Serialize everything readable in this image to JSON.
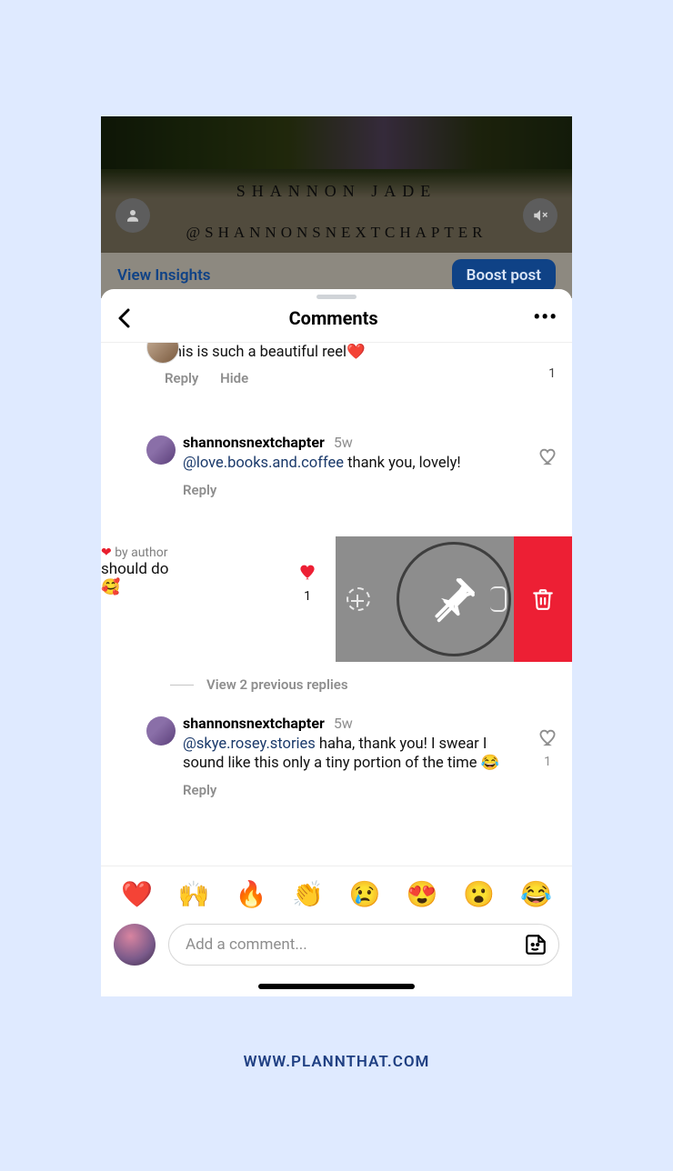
{
  "post": {
    "author_name": "SHANNON JADE",
    "author_handle": "@SHANNONSNEXTCHAPTER",
    "view_insights": "View Insights",
    "boost": "Boost post"
  },
  "sheet": {
    "title": "Comments"
  },
  "cut_comment": {
    "text": "This is such a beautiful reel",
    "heart": "❤️",
    "like_count": "1",
    "reply": "Reply",
    "hide": "Hide"
  },
  "reply1": {
    "username": "shannonsnextchapter",
    "time": "5w",
    "mention": "@love.books.and.coffee",
    "body_rest": " thank you, lovely!",
    "reply": "Reply"
  },
  "swipe": {
    "byline_icon": "❤",
    "byline": " by author",
    "line1": "should do",
    "line2": "🥰",
    "like_count": "1"
  },
  "view_prev": "View 2 previous replies",
  "reply2": {
    "username": "shannonsnextchapter",
    "time": "5w",
    "mention": "@skye.rosey.stories",
    "body_rest": " haha, thank you! I swear I sound like this only a tiny portion of the time 😂",
    "like_count": "1",
    "reply": "Reply"
  },
  "composer": {
    "emojis": [
      "❤️",
      "🙌",
      "🔥",
      "👏",
      "😢",
      "😍",
      "😮",
      "😂"
    ],
    "placeholder": "Add a comment..."
  },
  "footer_url": "WWW.PLANNTHAT.COM"
}
